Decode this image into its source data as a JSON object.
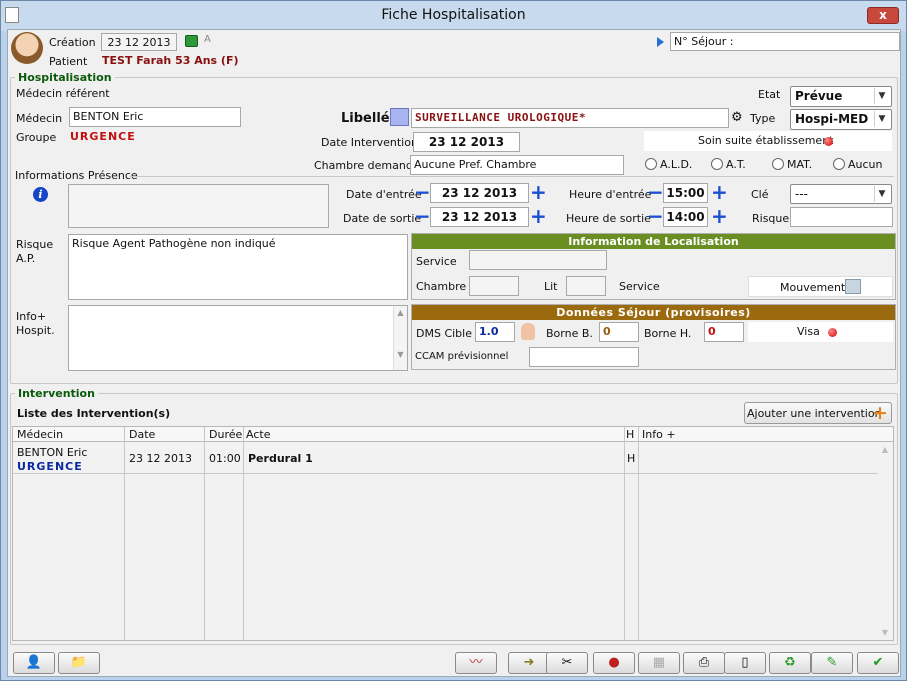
{
  "window": {
    "title": "Fiche Hospitalisation",
    "close_label": "x"
  },
  "header": {
    "creation_label": "Création",
    "creation_date": "23 12 2013",
    "a_label": "A",
    "patient_label": "Patient",
    "patient_value": "TEST Farah 53 Ans (F)",
    "sejour_label": "N° Séjour :",
    "sejour_value": ""
  },
  "hospitalisation": {
    "legend": "Hospitalisation",
    "medecin_referent_label": "Médecin référent",
    "medecin_label": "Médecin",
    "medecin_value": "BENTON Eric",
    "groupe_label": "Groupe",
    "groupe_value": "URGENCE",
    "libelle_label": "Libellé",
    "libelle_value": "SURVEILLANCE UROLOGIQUE*",
    "etat_label": "Etat",
    "etat_value": "Prévue",
    "type_label": "Type",
    "type_value": "Hospi-MED",
    "date_intervention_label": "Date Intervention",
    "date_intervention_value": "23 12 2013",
    "soin_suite_label": "Soin suite établissement",
    "chambre_label": "Chambre demandée",
    "chambre_value": "Aucune Pref. Chambre",
    "radios": [
      "A.L.D.",
      "A.T.",
      "MAT.",
      "Aucun"
    ]
  },
  "presence": {
    "legend": "Informations Présence",
    "info_icon": "info-icon",
    "date_entree_label": "Date d'entrée",
    "date_entree_value": "23 12 2013",
    "date_sortie_label": "Date de sortie",
    "date_sortie_value": "23 12 2013",
    "heure_entree_label": "Heure d'entrée",
    "heure_entree_value": "15:00",
    "heure_sortie_label": "Heure de sortie",
    "heure_sortie_value": "14:00",
    "cle_label": "Clé",
    "cle_value": "---",
    "risque_label": "Risque",
    "risque_value": "",
    "minus": "−",
    "plus": "+"
  },
  "risque_ap": {
    "label1": "Risque",
    "label2": "A.P.",
    "value": "Risque Agent Pathogène non indiqué"
  },
  "info_hospit": {
    "label1": "Info+",
    "label2": "Hospit.",
    "value": ""
  },
  "localisation": {
    "header": "Information de Localisation",
    "service_label": "Service",
    "service_value": "",
    "chambre_label": "Chambre",
    "chambre_value": "",
    "lit_label": "Lit",
    "lit_value": "",
    "service2_label": "Service",
    "mouvement_label": "Mouvement"
  },
  "sejour": {
    "header": "Données Séjour (provisoires)",
    "dms_label": "DMS Cible",
    "dms_value": "1.0",
    "borne_b_label": "Borne B.",
    "borne_b_value": "0",
    "borne_h_label": "Borne H.",
    "borne_h_value": "0",
    "visa_label": "Visa",
    "ccam_label": "CCAM prévisionnel",
    "ccam_value": ""
  },
  "intervention": {
    "legend": "Intervention",
    "list_title": "Liste des Intervention(s)",
    "add_button": "Ajouter une intervention",
    "columns": [
      "Médecin",
      "Date",
      "Durée",
      "Acte",
      "H",
      "Info +"
    ],
    "rows": [
      {
        "medecin": "BENTON Eric",
        "groupe": "URGENCE",
        "date": "23 12 2013",
        "duree": "01:00",
        "acte": "Perdural 1",
        "h": "H",
        "info": ""
      }
    ]
  },
  "toolbar": {
    "icons": [
      "doctor-icon",
      "folder-icon",
      "chart-icon",
      "forward-icon",
      "tools-icon",
      "contact-icon",
      "calendar-icon",
      "print-icon",
      "device-icon",
      "recycle-icon",
      "edit-check-icon",
      "validate-icon"
    ]
  },
  "colors": {
    "accent_green": "#6b8e23",
    "accent_brown": "#9b6a0e",
    "title_bg": "#c7daee",
    "urgent_red": "#c01010"
  }
}
